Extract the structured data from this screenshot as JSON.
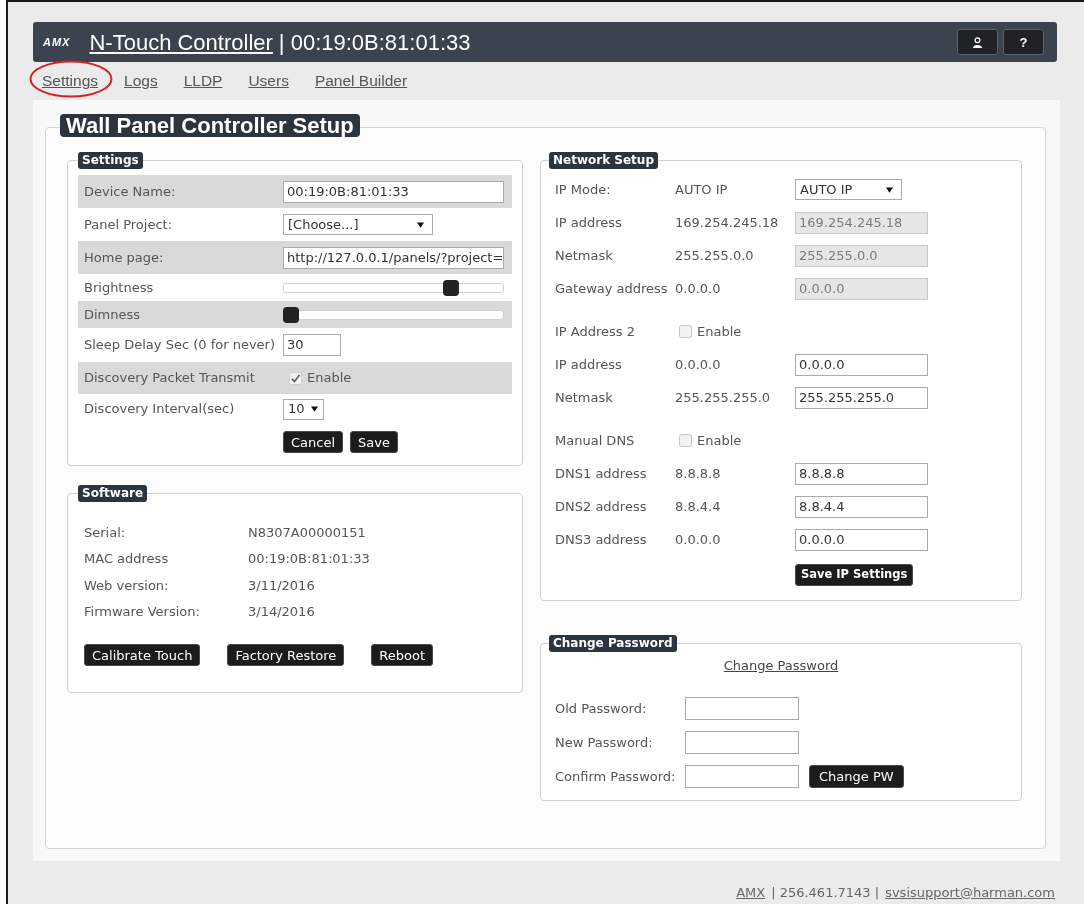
{
  "header": {
    "logo": "AMX",
    "title": "N-Touch Controller",
    "device": "| 00:19:0B:81:01:33",
    "help_button": "?"
  },
  "nav": [
    {
      "label": "Settings",
      "circled": true
    },
    {
      "label": "Logs",
      "circled": false
    },
    {
      "label": "LLDP",
      "circled": false
    },
    {
      "label": "Users",
      "circled": false
    },
    {
      "label": "Panel Builder",
      "circled": false
    }
  ],
  "page_title": "Wall Panel Controller Setup",
  "settings": {
    "title": "Settings",
    "rows": [
      {
        "kind": "input",
        "label": "Device Name:",
        "value": "00:19:0B:81:01:33"
      },
      {
        "kind": "select",
        "label": "Panel Project:",
        "value": "[Choose...]"
      },
      {
        "kind": "input",
        "label": "Home page:",
        "value": "http://127.0.0.1/panels/?project="
      },
      {
        "kind": "slider",
        "label": "Brightness",
        "level": 0.78
      },
      {
        "kind": "slider",
        "label": "Dimness",
        "level": 0
      },
      {
        "kind": "short-input",
        "label": "Sleep Delay Sec (0 for never)",
        "value": "30"
      },
      {
        "kind": "checkbox",
        "label": "Discovery Packet Transmit",
        "option": "Enable",
        "checked": true
      },
      {
        "kind": "short-select",
        "label": "Discovery Interval(sec)",
        "value": "10"
      }
    ],
    "buttons": [
      "Cancel",
      "Save"
    ]
  },
  "software": {
    "title": "Software",
    "rows": [
      {
        "label": "Serial:",
        "value": "N8307A00000151"
      },
      {
        "label": "MAC address",
        "value": "00:19:0B:81:01:33"
      },
      {
        "label": "Web version:",
        "value": "3/11/2016"
      },
      {
        "label": "Firmware Version:",
        "value": "3/14/2016"
      }
    ],
    "buttons": [
      "Calibrate Touch",
      "Factory Restore",
      "Reboot"
    ]
  },
  "network": {
    "title": "Network Setup",
    "rows": [
      {
        "kind": "select",
        "label": "IP Mode:",
        "current": "AUTO IP",
        "value": "AUTO IP"
      },
      {
        "kind": "field",
        "label": "IP address",
        "current": "169.254.245.18",
        "value": "169.254.245.18",
        "disabled": true
      },
      {
        "kind": "field",
        "label": "Netmask",
        "current": "255.255.0.0",
        "value": "255.255.0.0",
        "disabled": true
      },
      {
        "kind": "field",
        "label": "Gateway address",
        "current": "0.0.0.0",
        "value": "0.0.0.0",
        "disabled": true
      },
      {
        "kind": "checkbox",
        "label": "IP Address 2",
        "option": "Enable",
        "checked": false
      },
      {
        "kind": "field",
        "label": "IP address",
        "current": "0.0.0.0",
        "value": "0.0.0.0",
        "disabled": false
      },
      {
        "kind": "field",
        "label": "Netmask",
        "current": "255.255.255.0",
        "value": "255.255.255.0",
        "disabled": false
      },
      {
        "kind": "checkbox",
        "label": "Manual DNS",
        "option": "Enable",
        "checked": false
      },
      {
        "kind": "field",
        "label": "DNS1 address",
        "current": "8.8.8.8",
        "value": "8.8.8.8",
        "disabled": false
      },
      {
        "kind": "field",
        "label": "DNS2 address",
        "current": "8.8.4.4",
        "value": "8.8.4.4",
        "disabled": false
      },
      {
        "kind": "field",
        "label": "DNS3 address",
        "current": "0.0.0.0",
        "value": "0.0.0.0",
        "disabled": false
      }
    ],
    "button": "Save IP Settings"
  },
  "password": {
    "title": "Change Password",
    "link": "Change Password",
    "rows": [
      {
        "label": "Old Password:"
      },
      {
        "label": "New Password:"
      },
      {
        "label": "Confirm Password:"
      }
    ],
    "button": "Change PW"
  },
  "footer": [
    {
      "kind": "link",
      "text": "AMX"
    },
    {
      "kind": "text",
      "text": "| 256.461.7143 |"
    },
    {
      "kind": "link",
      "text": "svsisupport@harman.com"
    }
  ]
}
